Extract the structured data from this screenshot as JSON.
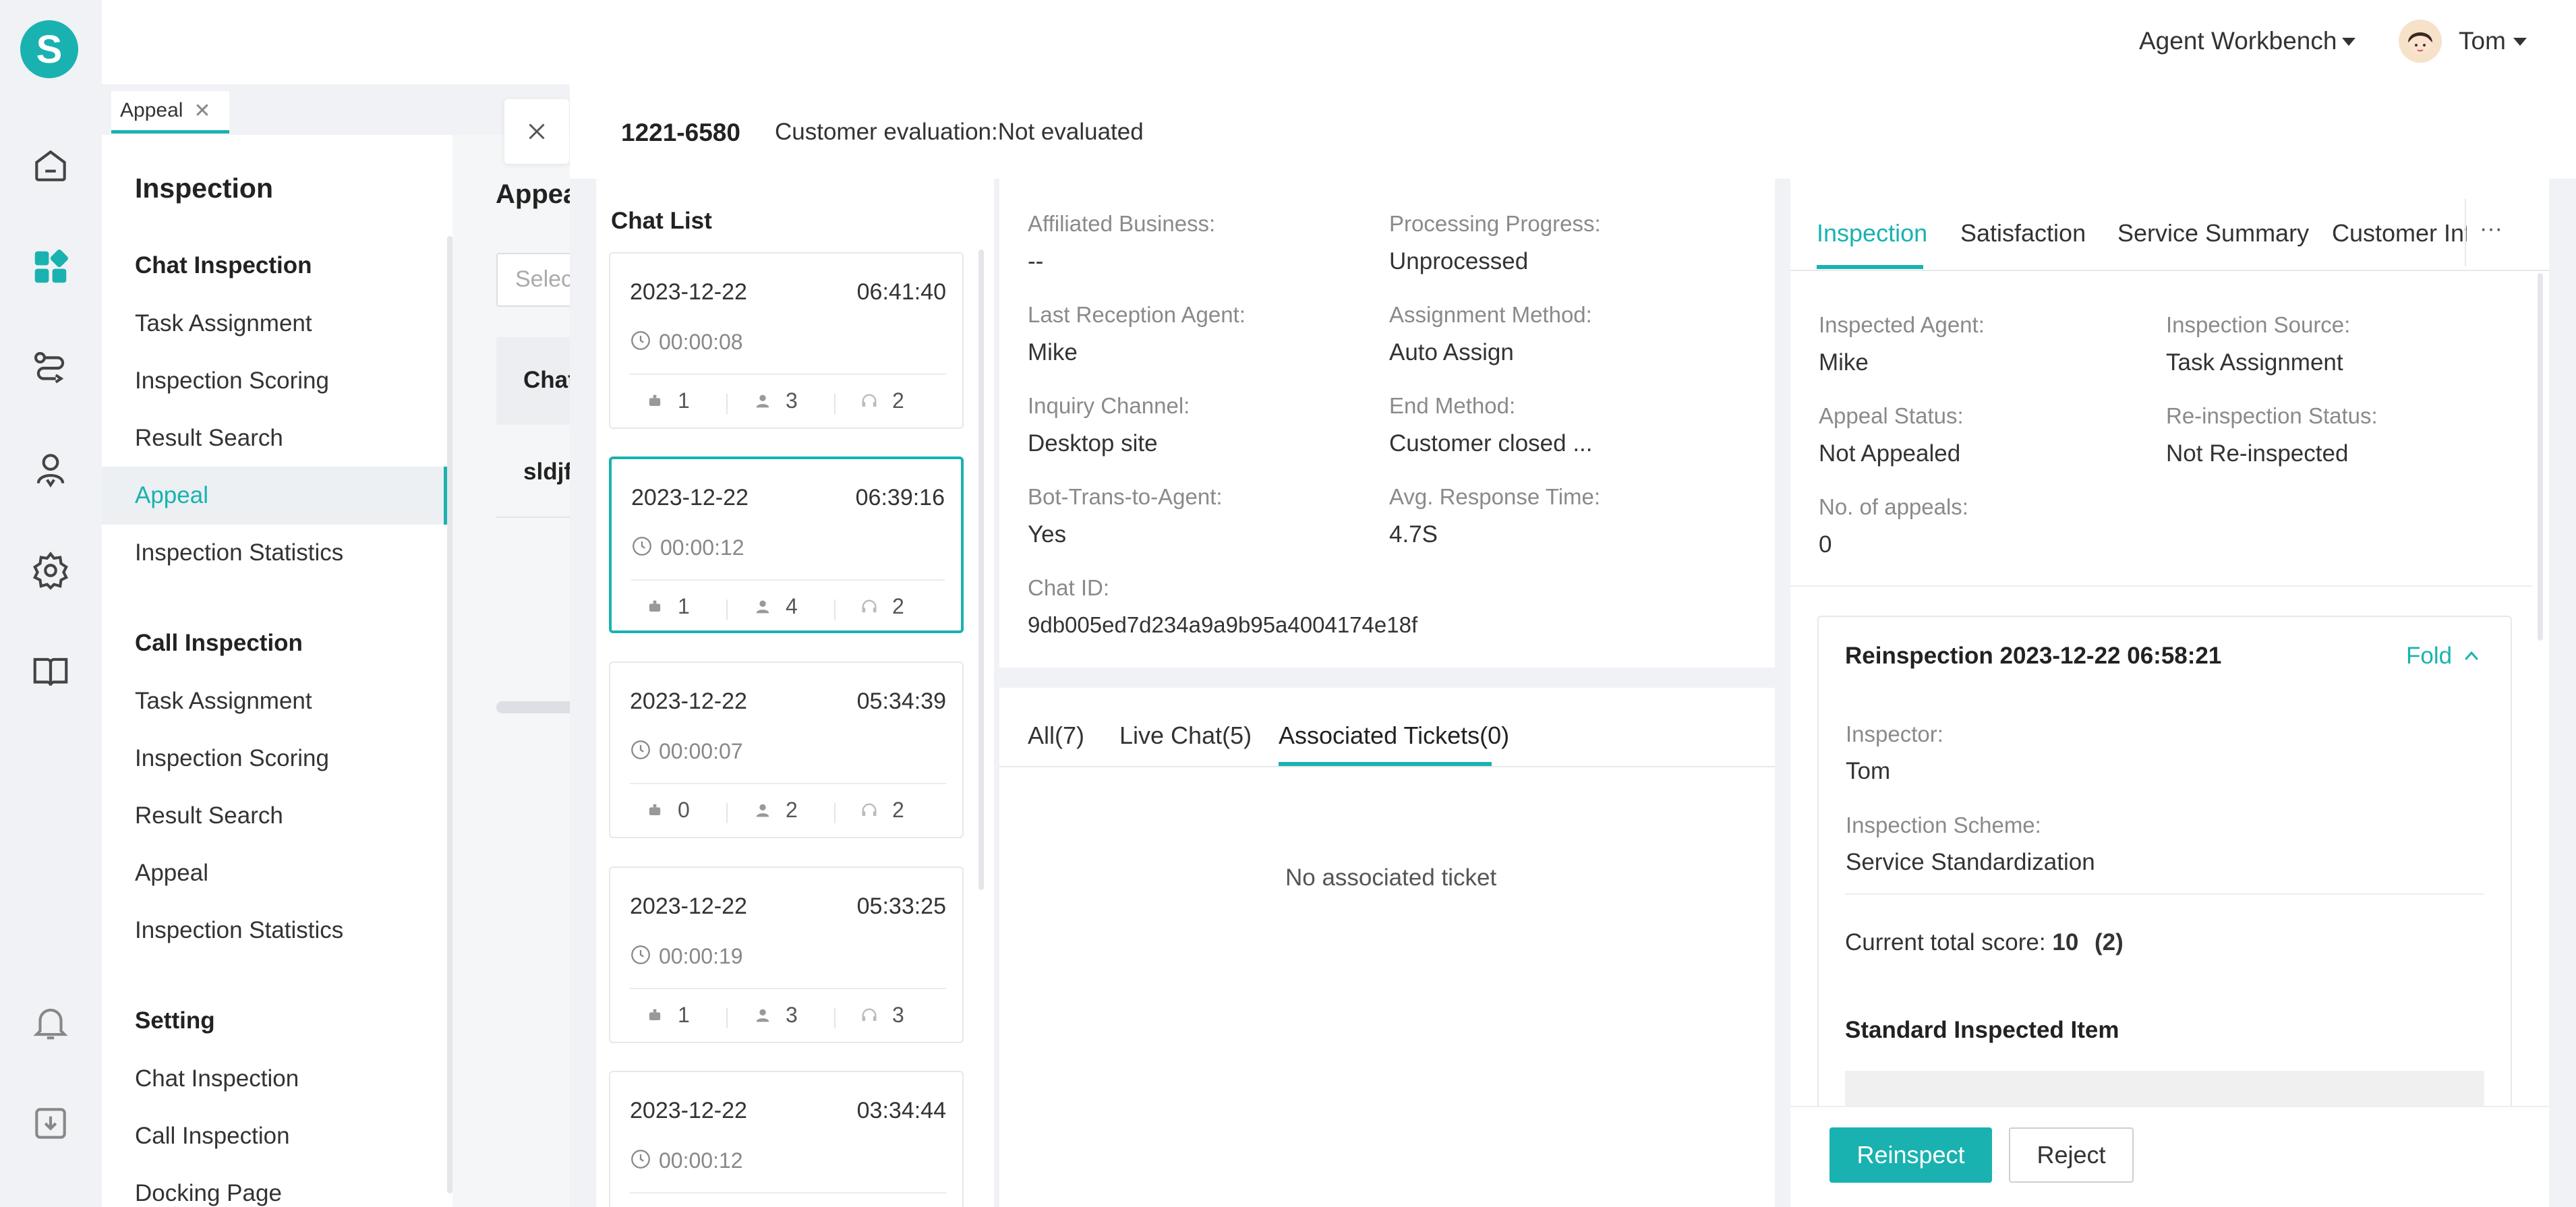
{
  "app": {
    "logo_letter": "S"
  },
  "topbar": {
    "workbench_label": "Agent Workbench",
    "user_name": "Tom"
  },
  "tabs": [
    {
      "label": "Appeal"
    }
  ],
  "subnav": {
    "title": "Inspection",
    "sections": [
      {
        "heading": "Chat Inspection",
        "items": [
          "Task Assignment",
          "Inspection Scoring",
          "Result Search",
          "Appeal",
          "Inspection Statistics"
        ]
      },
      {
        "heading": "Call Inspection",
        "items": [
          "Task Assignment",
          "Inspection Scoring",
          "Result Search",
          "Appeal",
          "Inspection Statistics"
        ]
      },
      {
        "heading": "Setting",
        "items": [
          "Chat Inspection",
          "Call Inspection",
          "Docking Page"
        ]
      }
    ],
    "active_item": "Appeal"
  },
  "underpage": {
    "title": "Appea",
    "select_placeholder": "Selec",
    "col_header": "Chat",
    "row_text": "sldjf"
  },
  "drawer": {
    "chat_number": "1221-6580",
    "evaluation_text": "Customer evaluation:Not evaluated",
    "chat_list_title": "Chat List",
    "chats": [
      {
        "date": "2023-12-22",
        "time": "06:41:40",
        "duration": "00:00:08",
        "bot": "1",
        "customer": "3",
        "agent": "2",
        "selected": false
      },
      {
        "date": "2023-12-22",
        "time": "06:39:16",
        "duration": "00:00:12",
        "bot": "1",
        "customer": "4",
        "agent": "2",
        "selected": true
      },
      {
        "date": "2023-12-22",
        "time": "05:34:39",
        "duration": "00:00:07",
        "bot": "0",
        "customer": "2",
        "agent": "2",
        "selected": false
      },
      {
        "date": "2023-12-22",
        "time": "05:33:25",
        "duration": "00:00:19",
        "bot": "1",
        "customer": "3",
        "agent": "3",
        "selected": false
      },
      {
        "date": "2023-12-22",
        "time": "03:34:44",
        "duration": "00:00:12",
        "bot": "",
        "customer": "",
        "agent": "",
        "selected": false
      }
    ],
    "info": {
      "affiliated_business_label": "Affiliated Business:",
      "affiliated_business": "--",
      "processing_progress_label": "Processing Progress:",
      "processing_progress": "Unprocessed",
      "last_agent_label": "Last Reception Agent:",
      "last_agent": "Mike",
      "assignment_method_label": "Assignment Method:",
      "assignment_method": "Auto Assign",
      "inquiry_channel_label": "Inquiry Channel:",
      "inquiry_channel": "Desktop site",
      "end_method_label": "End Method:",
      "end_method": "Customer closed ...",
      "bot_trans_label": "Bot-Trans-to-Agent:",
      "bot_trans": "Yes",
      "avg_response_label": "Avg. Response Time:",
      "avg_response": "4.7S",
      "chat_id_label": "Chat ID:",
      "chat_id": "9db005ed7d234a9a9b95a4004174e18f"
    },
    "content_tabs": {
      "all": "All(7)",
      "live_chat": "Live Chat(5)",
      "tickets": "Associated Tickets(0)"
    },
    "no_ticket_text": "No associated ticket",
    "right_tabs": [
      "Inspection",
      "Satisfaction",
      "Service Summary",
      "Customer Inf"
    ],
    "more_label": "···",
    "inspection": {
      "inspected_agent_label": "Inspected Agent:",
      "inspected_agent": "Mike",
      "source_label": "Inspection Source:",
      "source": "Task Assignment",
      "appeal_status_label": "Appeal Status:",
      "appeal_status": "Not Appealed",
      "reinspection_status_label": "Re-inspection Status:",
      "reinspection_status": "Not Re-inspected",
      "appeals_label": "No. of appeals:",
      "appeals": "0"
    },
    "reinspection": {
      "title": "Reinspection 2023-12-22 06:58:21",
      "fold_label": "Fold",
      "inspector_label": "Inspector:",
      "inspector": "Tom",
      "scheme_label": "Inspection Scheme:",
      "scheme": "Service Standardization",
      "score_label": "Current total score:",
      "score": "10",
      "score_extra": "(2)",
      "standard_item_label": "Standard Inspected Item"
    },
    "buttons": {
      "reinspect": "Reinspect",
      "reject": "Reject"
    }
  },
  "colors": {
    "accent": "#19b2b0",
    "text": "#333333",
    "muted": "#8a8a8a"
  }
}
